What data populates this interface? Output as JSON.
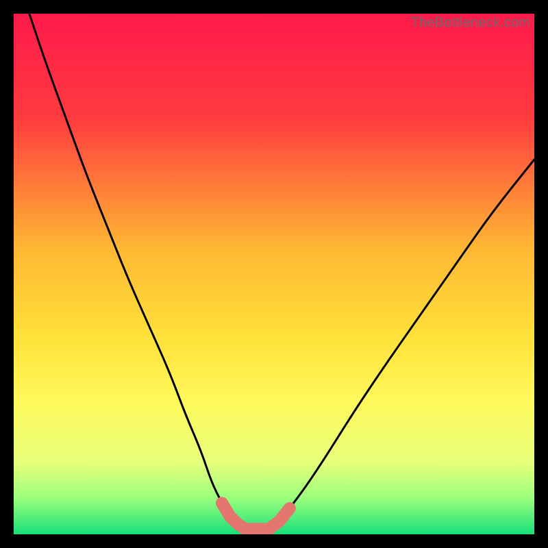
{
  "watermark": "TheBottleneck.com",
  "chart_data": {
    "type": "line",
    "title": "",
    "xlabel": "",
    "ylabel": "",
    "xlim": [
      0,
      100
    ],
    "ylim": [
      0,
      100
    ],
    "background_gradient": {
      "stops": [
        {
          "offset": 0,
          "color": "#ff1a4b"
        },
        {
          "offset": 20,
          "color": "#ff3b3f"
        },
        {
          "offset": 45,
          "color": "#ffb733"
        },
        {
          "offset": 62,
          "color": "#ffe13a"
        },
        {
          "offset": 74,
          "color": "#fff85a"
        },
        {
          "offset": 86,
          "color": "#e8ff7a"
        },
        {
          "offset": 93,
          "color": "#9cff7c"
        },
        {
          "offset": 100,
          "color": "#18e07a"
        }
      ]
    },
    "series": [
      {
        "name": "left-curve",
        "x": [
          3,
          6,
          10,
          14,
          18,
          22,
          26,
          30,
          33,
          36,
          38,
          40,
          41.5,
          43,
          44.5
        ],
        "y": [
          100,
          91,
          80,
          69,
          59,
          49,
          40,
          31,
          23,
          16,
          10,
          6,
          3.5,
          2,
          1
        ]
      },
      {
        "name": "right-curve",
        "x": [
          49,
          51,
          53,
          56,
          60,
          65,
          71,
          78,
          85,
          92,
          100
        ],
        "y": [
          1,
          2.5,
          5,
          9,
          15,
          23,
          32,
          42,
          52,
          62,
          72
        ]
      },
      {
        "name": "minimum-floor",
        "x": [
          44.5,
          49
        ],
        "y": [
          1,
          1
        ]
      }
    ],
    "markers": [
      {
        "x": 40,
        "y": 6,
        "r": 6,
        "color": "#e5766f"
      },
      {
        "x": 41.5,
        "y": 3.5,
        "r": 7,
        "color": "#e5766f"
      },
      {
        "x": 43,
        "y": 2,
        "r": 8,
        "color": "#e5766f"
      },
      {
        "x": 44.5,
        "y": 1,
        "r": 9,
        "color": "#e5766f"
      },
      {
        "x": 47,
        "y": 1,
        "r": 9,
        "color": "#e5766f"
      },
      {
        "x": 49,
        "y": 1,
        "r": 9,
        "color": "#e5766f"
      },
      {
        "x": 51,
        "y": 2.5,
        "r": 8,
        "color": "#e5766f"
      },
      {
        "x": 53,
        "y": 5,
        "r": 6,
        "color": "#e5766f"
      }
    ],
    "legend": null
  }
}
